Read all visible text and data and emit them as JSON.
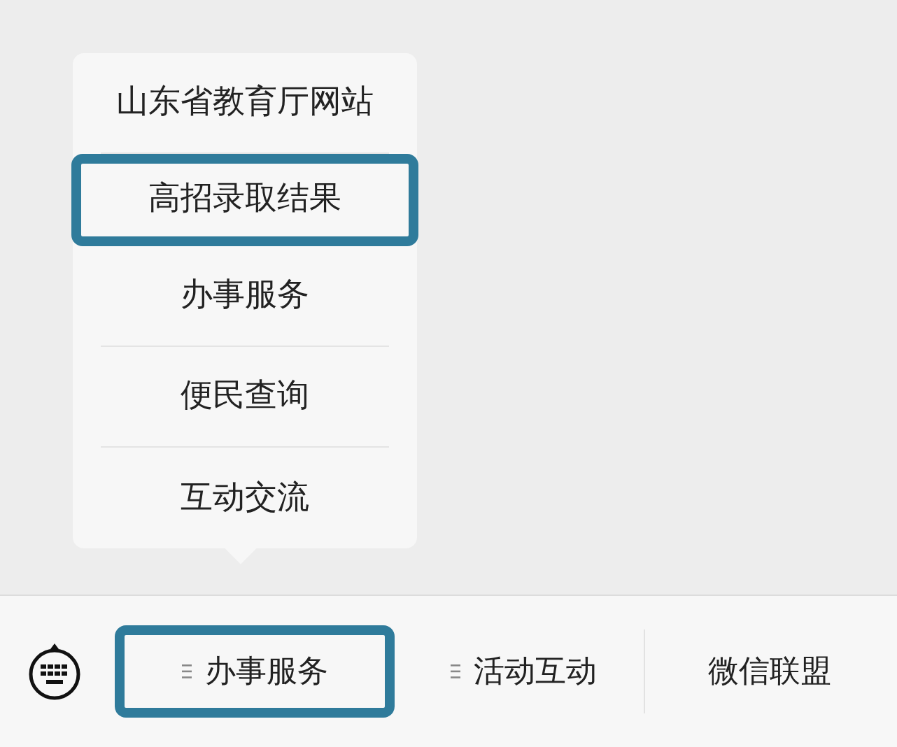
{
  "popup_menu": {
    "items": [
      {
        "label": "山东省教育厅网站",
        "highlighted": false
      },
      {
        "label": "高招录取结果",
        "highlighted": true
      },
      {
        "label": "办事服务",
        "highlighted": false
      },
      {
        "label": "便民查询",
        "highlighted": false
      },
      {
        "label": "互动交流",
        "highlighted": false
      }
    ]
  },
  "bottom_menu": {
    "tabs": [
      {
        "label": "办事服务",
        "has_submenu": true,
        "highlighted": true
      },
      {
        "label": "活动互动",
        "has_submenu": true,
        "highlighted": false
      },
      {
        "label": "微信联盟",
        "has_submenu": false,
        "highlighted": false
      }
    ]
  }
}
